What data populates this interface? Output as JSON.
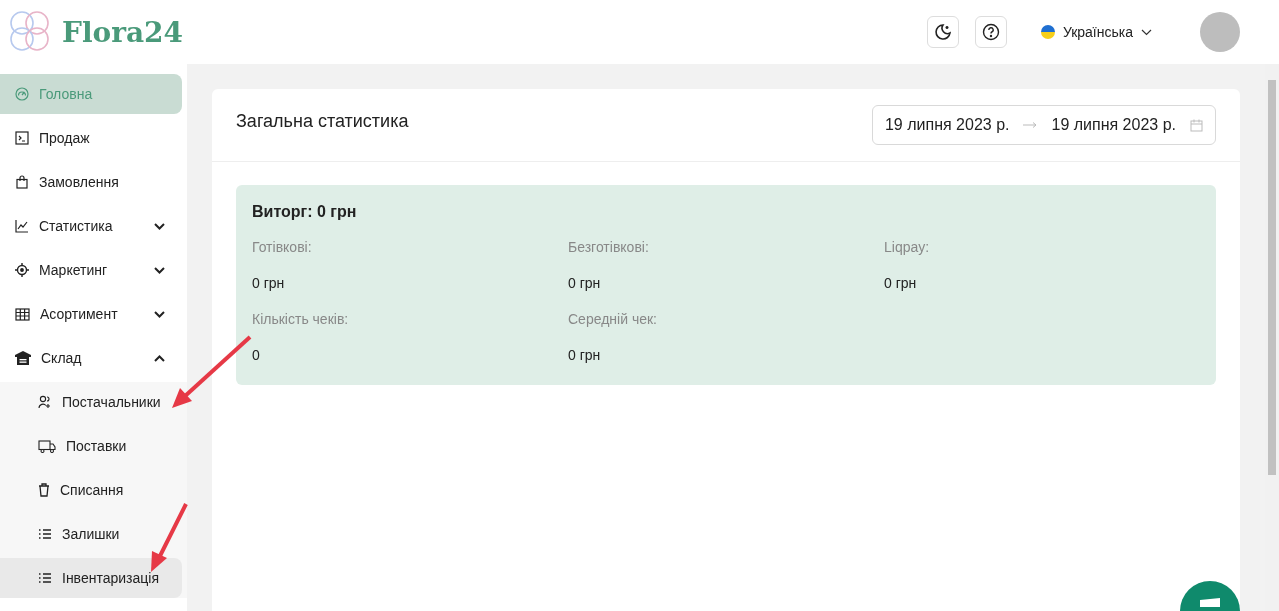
{
  "logo": {
    "text": "Flora24"
  },
  "header": {
    "language": "Українська"
  },
  "sidebar": {
    "items": [
      {
        "label": "Головна",
        "selected": true
      },
      {
        "label": "Продаж",
        "selected": false
      },
      {
        "label": "Замовлення",
        "selected": false
      },
      {
        "label": "Статистика",
        "selected": false,
        "expanded": false
      },
      {
        "label": "Маркетинг",
        "selected": false,
        "expanded": false
      },
      {
        "label": "Асортимент",
        "selected": false,
        "expanded": false
      },
      {
        "label": "Склад",
        "selected": false,
        "expanded": true,
        "children": [
          {
            "label": "Постачальники",
            "highlighted": false
          },
          {
            "label": "Поставки",
            "highlighted": false
          },
          {
            "label": "Списання",
            "highlighted": false
          },
          {
            "label": "Залишки",
            "highlighted": false
          },
          {
            "label": "Інвентаризація",
            "highlighted": true
          }
        ]
      }
    ]
  },
  "panel": {
    "title": "Загальна статистика",
    "date_from": "19 липня 2023 р.",
    "date_to": "19 липня 2023 р.",
    "revenue": "Виторг: 0 грн",
    "stats": [
      {
        "label": "Готівкові:",
        "value": "0 грн"
      },
      {
        "label": "Безготівкові:",
        "value": "0 грн"
      },
      {
        "label": "Liqpay:",
        "value": "0 грн"
      },
      {
        "label": "Кількість чеків:",
        "value": "0"
      },
      {
        "label": "Середній чек:",
        "value": "0 грн"
      }
    ]
  }
}
